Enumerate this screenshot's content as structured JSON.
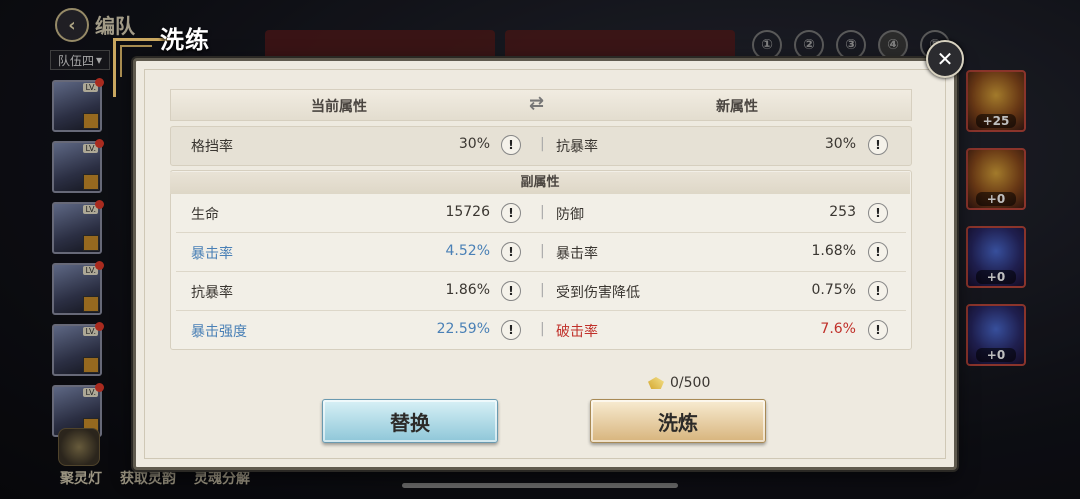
{
  "background": {
    "team_title": "编队",
    "team_select": "队伍四",
    "heroes": [
      {
        "level": "LV."
      },
      {
        "level": "LV."
      },
      {
        "level": "LV."
      },
      {
        "level": "LV."
      },
      {
        "level": "LV."
      },
      {
        "level": "LV."
      }
    ],
    "right_tabs": [
      "①",
      "②",
      "③",
      "④",
      "⑤"
    ],
    "equipment": [
      {
        "plus": "+25",
        "style": "gold"
      },
      {
        "plus": "+0",
        "style": "gold"
      },
      {
        "plus": "+0",
        "style": "blue"
      },
      {
        "plus": "+0",
        "style": "blue"
      }
    ],
    "bottom_menu": [
      "聚灵灯",
      "获取灵韵",
      "灵魂分解"
    ]
  },
  "modal": {
    "title": "洗练",
    "close_icon": "close-icon",
    "header": {
      "current": "当前属性",
      "swap_icon": "swap-arrows-icon",
      "new": "新属性"
    },
    "main_attr": {
      "left_name": "格挡率",
      "left_value": "30%",
      "right_name": "抗暴率",
      "right_value": "30%"
    },
    "sub_header": "副属性",
    "sub_attrs": [
      {
        "left_name": "生命",
        "left_value": "15726",
        "left_color": "normal",
        "right_name": "防御",
        "right_value": "253",
        "right_color": "normal"
      },
      {
        "left_name": "暴击率",
        "left_value": "4.52%",
        "left_color": "blue",
        "right_name": "暴击率",
        "right_value": "1.68%",
        "right_color": "normal"
      },
      {
        "left_name": "抗暴率",
        "left_value": "1.86%",
        "left_color": "normal",
        "right_name": "受到伤害降低",
        "right_value": "0.75%",
        "right_color": "normal"
      },
      {
        "left_name": "暴击强度",
        "left_value": "22.59%",
        "left_color": "blue",
        "right_name": "破击率",
        "right_value": "7.6%",
        "right_color": "red"
      }
    ],
    "cost": "0/500",
    "replace_label": "替换",
    "refine_label": "洗炼"
  },
  "colors": {
    "blue_text": "#4a80b6",
    "red_text": "#c0302a",
    "modal_bg": "#eeeae0"
  }
}
